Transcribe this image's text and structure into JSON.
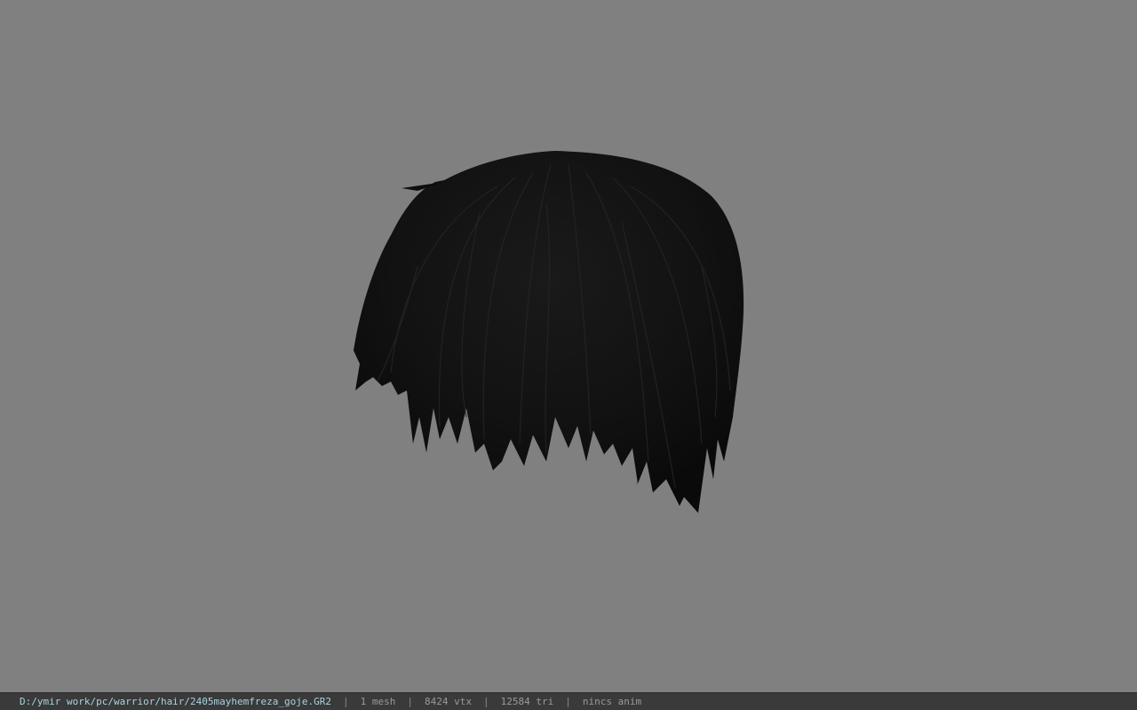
{
  "viewer": {
    "background_color": "#808080",
    "model": {
      "name": "hair-mesh",
      "color": "#111111"
    }
  },
  "statusbar": {
    "file_path": "D:/ymir work/pc/warrior/hair/2405mayhemfreza_goje.GR2",
    "separator": "|",
    "mesh_count": "1 mesh",
    "vertex_count": "8424 vtx",
    "triangle_count": "12584 tri",
    "anim_status": "nincs anim",
    "colors": {
      "background": "#3a3a3a",
      "path": "#a9d3df",
      "text": "#9a9a9a"
    }
  }
}
